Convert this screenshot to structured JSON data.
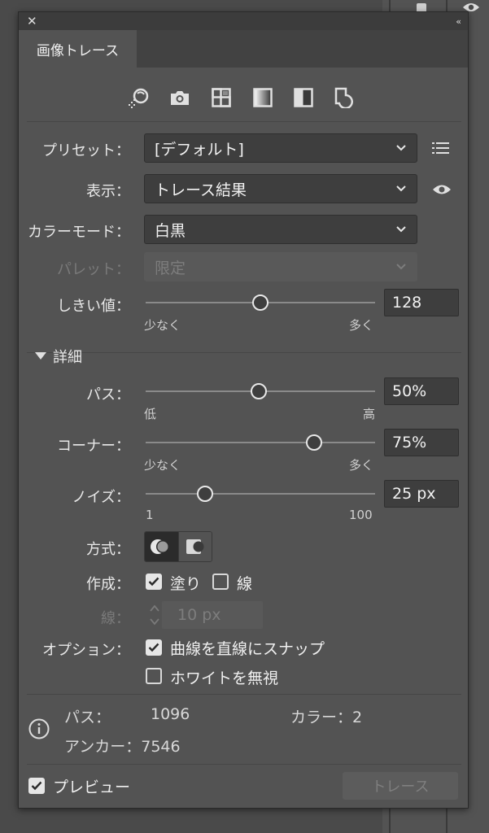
{
  "panel": {
    "tab_label": "画像トレース"
  },
  "icons": [
    "auto-color-icon",
    "camera-icon",
    "low-color-icon",
    "grayscale-icon",
    "black-white-icon",
    "outline-icon"
  ],
  "preset": {
    "label": "プリセット：",
    "value": "[デフォルト]"
  },
  "view": {
    "label": "表示：",
    "value": "トレース結果"
  },
  "color_mode": {
    "label": "カラーモード：",
    "value": "白黒"
  },
  "palette": {
    "label": "パレット：",
    "value": "限定"
  },
  "threshold": {
    "label": "しきい値：",
    "value": "128",
    "min_label": "少なく",
    "max_label": "多く",
    "fraction": 0.5
  },
  "advanced": {
    "label": "詳細"
  },
  "paths": {
    "label": "パス：",
    "value": "50%",
    "min_label": "低",
    "max_label": "高",
    "fraction": 0.5
  },
  "corners": {
    "label": "コーナー：",
    "value": "75%",
    "min_label": "少なく",
    "max_label": "多く",
    "fraction": 0.75
  },
  "noise": {
    "label": "ノイズ：",
    "value": "25 px",
    "min_label": "1",
    "max_label": "100",
    "fraction": 0.24
  },
  "method": {
    "label": "方式："
  },
  "create": {
    "label": "作成：",
    "fills_label": "塗り",
    "fills_checked": true,
    "strokes_label": "線",
    "strokes_checked": false
  },
  "stroke": {
    "label": "線：",
    "value": "10 px"
  },
  "options": {
    "label": "オプション：",
    "snap_label": "曲線を直線にスナップ",
    "snap_checked": true,
    "ignore_white_label": "ホワイトを無視",
    "ignore_white_checked": false
  },
  "info": {
    "paths_label": "パス：",
    "paths_value": "1096",
    "colors_label": "カラー：2",
    "anchors_label": "アンカー：7546"
  },
  "footer": {
    "preview_label": "プレビュー",
    "preview_checked": true,
    "trace_label": "トレース"
  }
}
